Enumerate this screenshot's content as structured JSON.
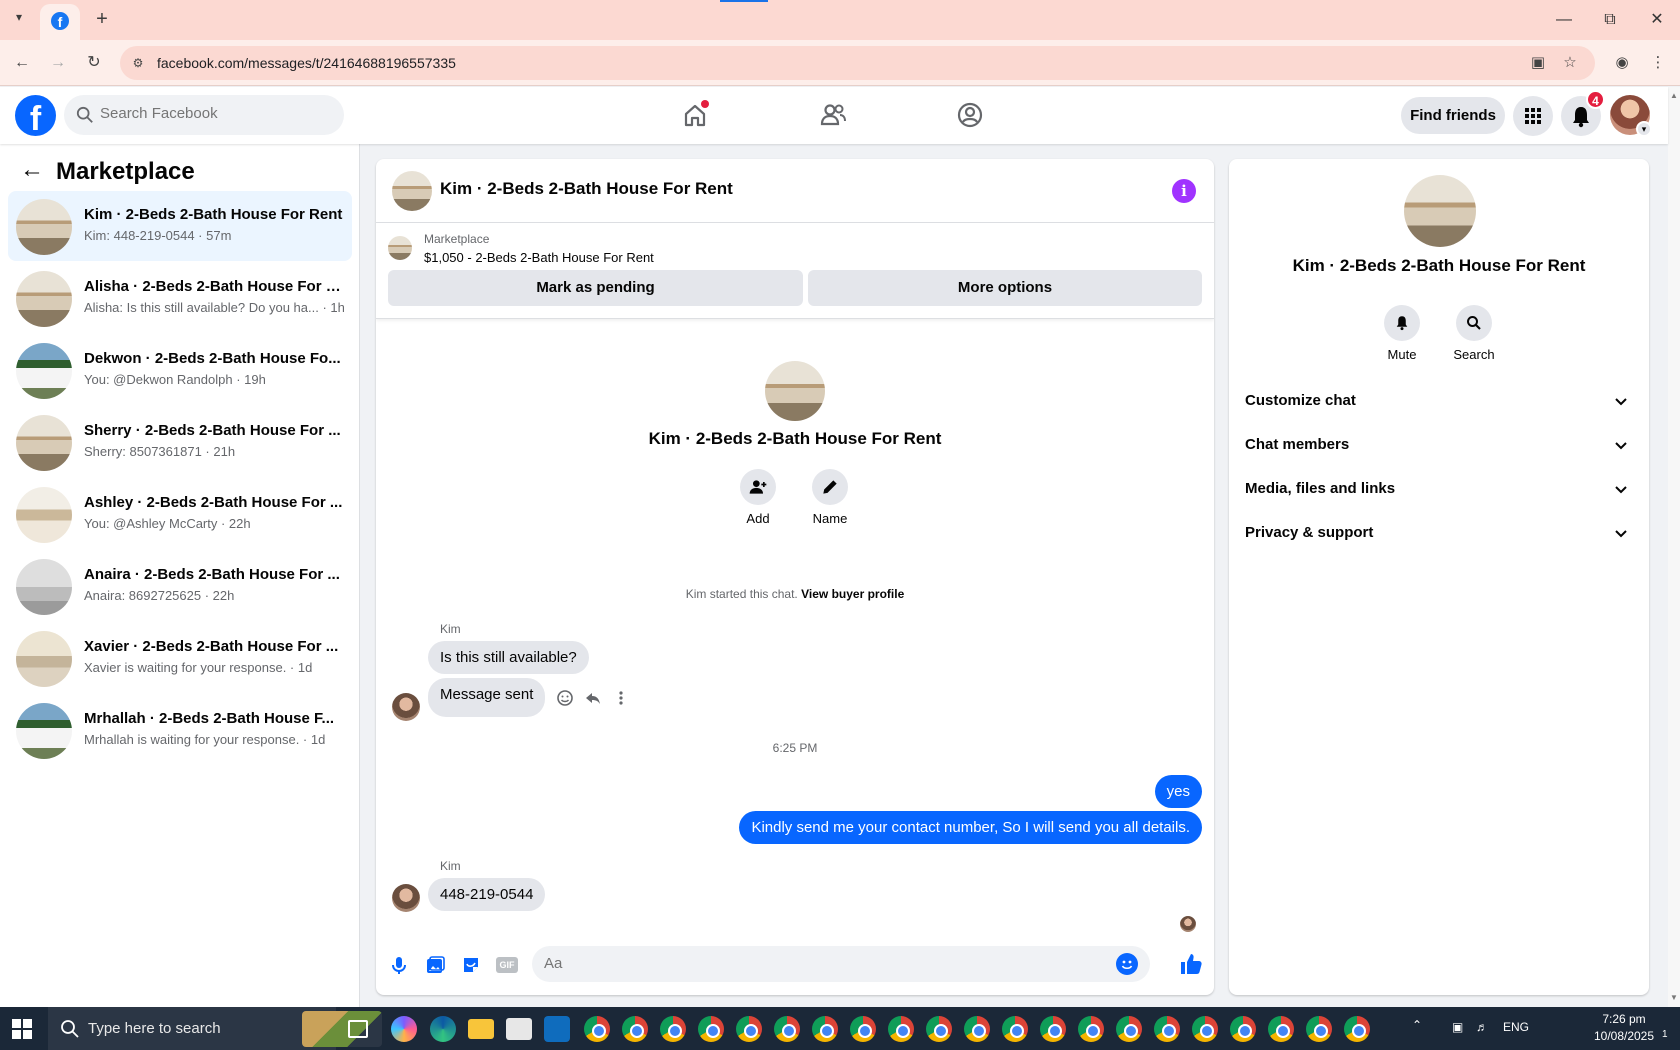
{
  "browser": {
    "url": "facebook.com/messages/t/24164688196557335",
    "tab_favicon": "f"
  },
  "header": {
    "logo_letter": "f",
    "search_placeholder": "Search Facebook",
    "find_friends": "Find friends",
    "notifications_badge": "4"
  },
  "sidebar": {
    "title": "Marketplace",
    "conversations": [
      {
        "name": "Kim · 2-Beds 2-Bath House For Rent",
        "preview": "Kim: 448-219-0544 · 57m",
        "active": true
      },
      {
        "name": "Alisha · 2-Beds 2-Bath House For R...",
        "preview": "Alisha: Is this still available? Do you ha... · 1h"
      },
      {
        "name": "Dekwon · 2-Beds 2-Bath House Fo...",
        "preview": "You: @Dekwon Randolph · 19h"
      },
      {
        "name": "Sherry · 2-Beds 2-Bath House For ...",
        "preview": "Sherry: 8507361871 · 21h"
      },
      {
        "name": "Ashley · 2-Beds 2-Bath House For ...",
        "preview": "You: @Ashley McCarty · 22h"
      },
      {
        "name": "Anaira · 2-Beds 2-Bath House For ...",
        "preview": "Anaira: 8692725625 · 22h"
      },
      {
        "name": "Xavier · 2-Beds 2-Bath House For ...",
        "preview": "Xavier is waiting for your response. · 1d"
      },
      {
        "name": "Mrhallah · 2-Beds 2-Bath House F...",
        "preview": "Mrhallah is waiting for your response. · 1d"
      }
    ]
  },
  "chat": {
    "title": "Kim · 2-Beds 2-Bath House For Rent",
    "listing": {
      "label": "Marketplace",
      "price_line": "$1,050 - 2-Beds 2-Bath House For Rent",
      "mark_pending": "Mark as pending",
      "more_options": "More options"
    },
    "intro": {
      "name": "Kim · 2-Beds 2-Bath House For Rent",
      "add_label": "Add",
      "name_label": "Name"
    },
    "started_text": "Kim started this chat.",
    "view_buyer_profile": "View buyer profile",
    "sender_name": "Kim",
    "messages": {
      "in_1": "Is this still available?",
      "in_2": "Message sent",
      "timestamp": "6:25 PM",
      "out_1": "yes",
      "out_2": "Kindly send me your contact number, So I will send you all details.",
      "in_3": "448-219-0544"
    },
    "composer_placeholder": "Aa",
    "composer_gif": "GIF"
  },
  "info": {
    "name": "Kim · 2-Beds 2-Bath House For Rent",
    "mute": "Mute",
    "search": "Search",
    "sections": [
      "Customize chat",
      "Chat members",
      "Media, files and links",
      "Privacy & support"
    ]
  },
  "taskbar": {
    "search_placeholder": "Type here to search",
    "lang": "ENG",
    "time": "7:26 pm",
    "date": "10/08/2025",
    "notif_count": "1"
  },
  "colors": {
    "fb_blue": "#0866ff",
    "accent_purple": "#a033ff",
    "badge_red": "#e41e3f"
  }
}
